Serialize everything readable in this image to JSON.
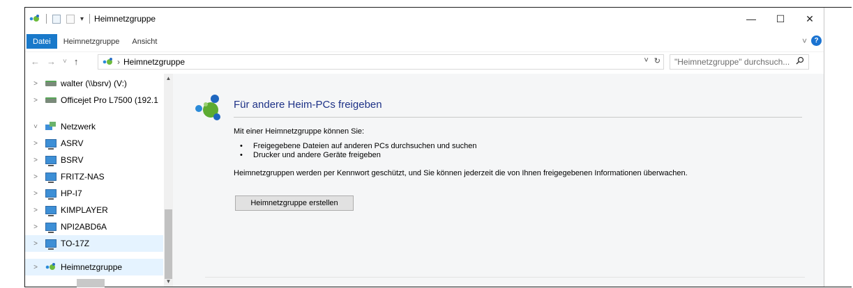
{
  "window": {
    "title": "Heimnetzgruppe",
    "qa_dropdown": "▾"
  },
  "controls": {
    "minimize": "—",
    "maximize": "☐",
    "close": "✕"
  },
  "ribbon": {
    "tabs": [
      "Datei",
      "Heimnetzgruppe",
      "Ansicht"
    ],
    "expand": "˅",
    "help": "?"
  },
  "nav": {
    "back": "←",
    "forward": "→",
    "recent": "˅",
    "up": "↑"
  },
  "address": {
    "separator": "›",
    "location": "Heimnetzgruppe",
    "dropdown": "˅",
    "refresh": "↻"
  },
  "search": {
    "placeholder": "\"Heimnetzgruppe\" durchsuch...",
    "icon": "search-icon"
  },
  "navpane": {
    "items": [
      {
        "label": "walter (\\\\bsrv) (V:)",
        "icon": "network-drive-icon",
        "chevron": ">"
      },
      {
        "label": "Officejet Pro L7500 (192.1",
        "icon": "network-drive-icon",
        "chevron": ">"
      },
      {
        "label": "Netzwerk",
        "icon": "network-icon",
        "chevron": "˅"
      },
      {
        "label": "ASRV",
        "icon": "computer-icon",
        "chevron": ">"
      },
      {
        "label": "BSRV",
        "icon": "computer-icon",
        "chevron": ">"
      },
      {
        "label": "FRITZ-NAS",
        "icon": "computer-icon",
        "chevron": ">"
      },
      {
        "label": "HP-I7",
        "icon": "computer-icon",
        "chevron": ">"
      },
      {
        "label": "KIMPLAYER",
        "icon": "computer-icon",
        "chevron": ">"
      },
      {
        "label": "NPI2ABD6A",
        "icon": "computer-icon",
        "chevron": ">"
      },
      {
        "label": "TO-17Z",
        "icon": "computer-icon",
        "chevron": ">"
      },
      {
        "label": "Heimnetzgruppe",
        "icon": "homegroup-icon",
        "chevron": ">"
      }
    ],
    "selected_index": 10,
    "hover_index": 9
  },
  "content": {
    "heading": "Für andere Heim-PCs freigeben",
    "intro": "Mit einer Heimnetzgruppe können Sie:",
    "bullets": [
      "Freigegebene Dateien auf anderen PCs durchsuchen und suchen",
      "Drucker und andere Geräte freigeben"
    ],
    "info": "Heimnetzgruppen werden per Kennwort geschützt, und Sie können jederzeit die von Ihnen freigegebenen Informationen überwachen.",
    "button": "Heimnetzgruppe erstellen"
  },
  "colors": {
    "accent": "#1979ca",
    "heading": "#1e3287",
    "selection": "#e5f3ff",
    "content_bg": "#f5f6f7"
  }
}
